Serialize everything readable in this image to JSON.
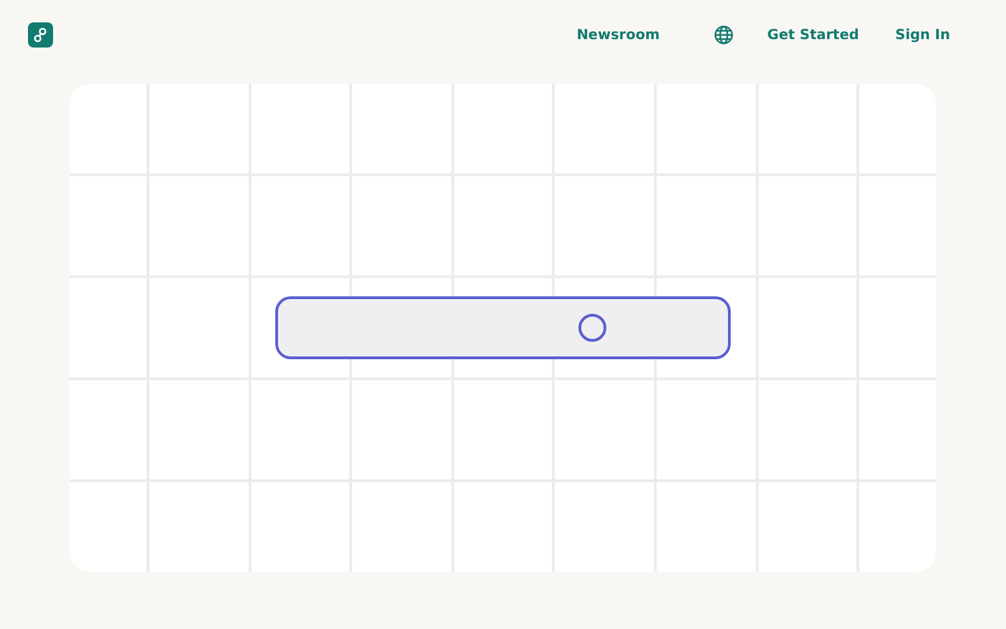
{
  "nav": {
    "links": [
      {
        "label": "Newsroom",
        "kind": "text"
      },
      {
        "kind": "globe"
      },
      {
        "label": "Get Started",
        "kind": "text"
      },
      {
        "label": "Sign In",
        "kind": "text"
      }
    ]
  }
}
